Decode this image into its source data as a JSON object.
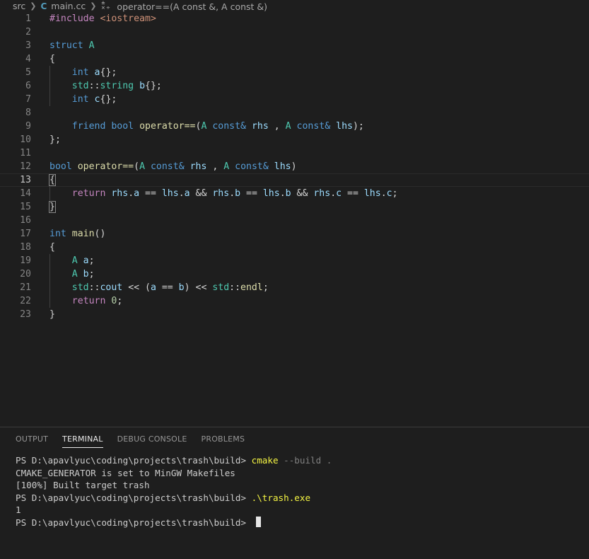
{
  "breadcrumb": {
    "folder": "src",
    "file_icon": "C",
    "file": "main.cc",
    "symbol": "operator==(A const &, A const &)"
  },
  "editor": {
    "lines": [
      {
        "n": "1",
        "tokens": [
          [
            "pp",
            "#include"
          ],
          [
            "",
            " "
          ],
          [
            "str",
            "<iostream>"
          ]
        ]
      },
      {
        "n": "2",
        "tokens": []
      },
      {
        "n": "3",
        "tokens": [
          [
            "kw",
            "struct"
          ],
          [
            "",
            " "
          ],
          [
            "typ",
            "A"
          ]
        ]
      },
      {
        "n": "4",
        "tokens": [
          [
            "",
            "{"
          ]
        ]
      },
      {
        "n": "5",
        "tokens": [
          [
            "",
            "    "
          ],
          [
            "kw",
            "int"
          ],
          [
            "",
            " "
          ],
          [
            "var",
            "a"
          ],
          [
            "",
            "{};"
          ]
        ]
      },
      {
        "n": "6",
        "tokens": [
          [
            "",
            "    "
          ],
          [
            "typ",
            "std"
          ],
          [
            "",
            "::"
          ],
          [
            "typ",
            "string"
          ],
          [
            "",
            " "
          ],
          [
            "var",
            "b"
          ],
          [
            "",
            "{};"
          ]
        ]
      },
      {
        "n": "7",
        "tokens": [
          [
            "",
            "    "
          ],
          [
            "kw",
            "int"
          ],
          [
            "",
            " "
          ],
          [
            "var",
            "c"
          ],
          [
            "",
            "{};"
          ]
        ]
      },
      {
        "n": "8",
        "tokens": []
      },
      {
        "n": "9",
        "tokens": [
          [
            "",
            "    "
          ],
          [
            "kw",
            "friend"
          ],
          [
            "",
            " "
          ],
          [
            "kw",
            "bool"
          ],
          [
            "",
            " "
          ],
          [
            "fn",
            "operator=="
          ],
          [
            "",
            "("
          ],
          [
            "typ",
            "A"
          ],
          [
            "",
            " "
          ],
          [
            "kw",
            "const"
          ],
          [
            "kw",
            "&"
          ],
          [
            "",
            " "
          ],
          [
            "var",
            "rhs"
          ],
          [
            "",
            " , "
          ],
          [
            "typ",
            "A"
          ],
          [
            "",
            " "
          ],
          [
            "kw",
            "const"
          ],
          [
            "kw",
            "&"
          ],
          [
            "",
            " "
          ],
          [
            "var",
            "lhs"
          ],
          [
            "",
            ");"
          ]
        ]
      },
      {
        "n": "10",
        "tokens": [
          [
            "",
            "};"
          ]
        ]
      },
      {
        "n": "11",
        "tokens": []
      },
      {
        "n": "12",
        "tokens": [
          [
            "kw",
            "bool"
          ],
          [
            "",
            " "
          ],
          [
            "fn",
            "operator=="
          ],
          [
            "",
            "("
          ],
          [
            "typ",
            "A"
          ],
          [
            "",
            " "
          ],
          [
            "kw",
            "const"
          ],
          [
            "kw",
            "&"
          ],
          [
            "",
            " "
          ],
          [
            "var",
            "rhs"
          ],
          [
            "",
            " , "
          ],
          [
            "typ",
            "A"
          ],
          [
            "",
            " "
          ],
          [
            "kw",
            "const"
          ],
          [
            "kw",
            "&"
          ],
          [
            "",
            " "
          ],
          [
            "var",
            "lhs"
          ],
          [
            "",
            ")"
          ]
        ]
      },
      {
        "n": "13",
        "tokens": [
          [
            "bm",
            "{"
          ]
        ]
      },
      {
        "n": "14",
        "tokens": [
          [
            "",
            "    "
          ],
          [
            "ctl",
            "return"
          ],
          [
            "",
            " "
          ],
          [
            "var",
            "rhs"
          ],
          [
            "",
            "."
          ],
          [
            "var",
            "a"
          ],
          [
            "",
            " == "
          ],
          [
            "var",
            "lhs"
          ],
          [
            "",
            "."
          ],
          [
            "var",
            "a"
          ],
          [
            "",
            " && "
          ],
          [
            "var",
            "rhs"
          ],
          [
            "",
            "."
          ],
          [
            "var",
            "b"
          ],
          [
            "",
            " == "
          ],
          [
            "var",
            "lhs"
          ],
          [
            "",
            "."
          ],
          [
            "var",
            "b"
          ],
          [
            "",
            " && "
          ],
          [
            "var",
            "rhs"
          ],
          [
            "",
            "."
          ],
          [
            "var",
            "c"
          ],
          [
            "",
            " == "
          ],
          [
            "var",
            "lhs"
          ],
          [
            "",
            "."
          ],
          [
            "var",
            "c"
          ],
          [
            "",
            ";"
          ]
        ]
      },
      {
        "n": "15",
        "tokens": [
          [
            "bm",
            "}"
          ]
        ]
      },
      {
        "n": "16",
        "tokens": []
      },
      {
        "n": "17",
        "tokens": [
          [
            "kw",
            "int"
          ],
          [
            "",
            " "
          ],
          [
            "fn",
            "main"
          ],
          [
            "",
            "()"
          ]
        ]
      },
      {
        "n": "18",
        "tokens": [
          [
            "",
            "{"
          ]
        ]
      },
      {
        "n": "19",
        "tokens": [
          [
            "",
            "    "
          ],
          [
            "typ",
            "A"
          ],
          [
            "",
            " "
          ],
          [
            "var",
            "a"
          ],
          [
            "",
            ";"
          ]
        ]
      },
      {
        "n": "20",
        "tokens": [
          [
            "",
            "    "
          ],
          [
            "typ",
            "A"
          ],
          [
            "",
            " "
          ],
          [
            "var",
            "b"
          ],
          [
            "",
            ";"
          ]
        ]
      },
      {
        "n": "21",
        "tokens": [
          [
            "",
            "    "
          ],
          [
            "typ",
            "std"
          ],
          [
            "",
            "::"
          ],
          [
            "var",
            "cout"
          ],
          [
            "",
            " << ("
          ],
          [
            "var",
            "a"
          ],
          [
            "",
            " == "
          ],
          [
            "var",
            "b"
          ],
          [
            "",
            ") << "
          ],
          [
            "typ",
            "std"
          ],
          [
            "",
            "::"
          ],
          [
            "fn",
            "endl"
          ],
          [
            "",
            ";"
          ]
        ]
      },
      {
        "n": "22",
        "tokens": [
          [
            "",
            "    "
          ],
          [
            "ctl",
            "return"
          ],
          [
            "",
            " "
          ],
          [
            "num",
            "0"
          ],
          [
            "",
            ";"
          ]
        ]
      },
      {
        "n": "23",
        "tokens": [
          [
            "",
            "}"
          ]
        ]
      }
    ]
  },
  "panel": {
    "tabs": [
      {
        "label": "OUTPUT",
        "active": false
      },
      {
        "label": "TERMINAL",
        "active": true
      },
      {
        "label": "DEBUG CONSOLE",
        "active": false
      },
      {
        "label": "PROBLEMS",
        "active": false
      }
    ],
    "terminal": {
      "prompt": "PS D:\\apavlyuc\\coding\\projects\\trash\\build> ",
      "cmd1": "cmake",
      "cmd1_args": " --build .",
      "out1": "CMAKE_GENERATOR is set to MinGW Makefiles",
      "out2": "[100%] Built target trash",
      "cmd2": ".\\trash.exe",
      "out3": "1"
    }
  },
  "colors": {
    "background": "#1e1e1e",
    "keyword": "#569cd6",
    "control": "#c586c0",
    "type": "#4ec9b0",
    "function": "#dcdcaa",
    "variable": "#9cdcfe",
    "string": "#ce9178",
    "number": "#b5cea8",
    "terminal_command": "#f5f543"
  }
}
